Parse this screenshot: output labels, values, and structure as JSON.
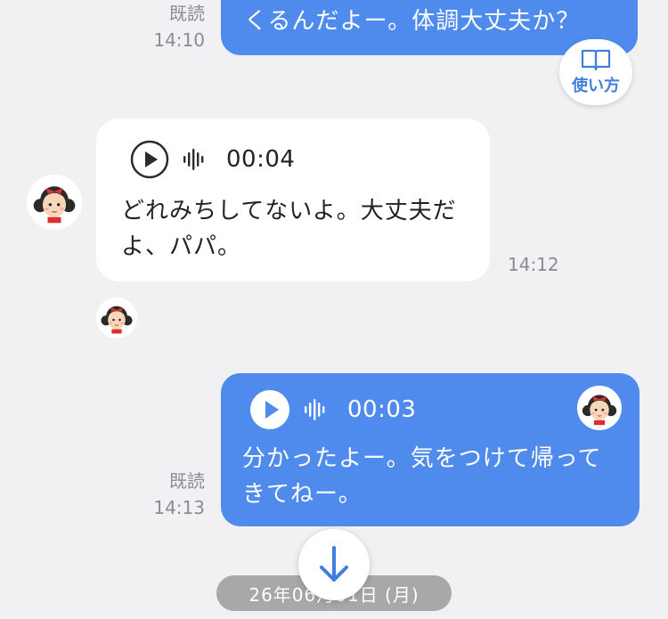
{
  "help": {
    "label": "使い方",
    "icon": "book-icon"
  },
  "messages": [
    {
      "direction": "out",
      "read": "既読",
      "time": "14:10",
      "text": "くるんだよー。体調大丈夫か？"
    },
    {
      "direction": "in",
      "duration": "00:04",
      "time": "14:12",
      "text_lines": [
        "どれみちしてないよ。大丈夫だ",
        "よ、パパ。"
      ]
    },
    {
      "direction": "out",
      "duration": "00:03",
      "read": "既読",
      "time": "14:13",
      "text_lines": [
        "分かったよー。気をつけて帰って",
        "きてねー。"
      ]
    }
  ],
  "date_separator": "26年06月01日 (月)",
  "colors": {
    "outgoing": "#4f8bec",
    "incoming": "#ffffff",
    "background": "#f1f1f3"
  },
  "icons": {
    "play": "play-icon",
    "waveform": "waveform-icon",
    "scroll_down": "arrow-down-icon",
    "avatar": "girl-avatar"
  }
}
